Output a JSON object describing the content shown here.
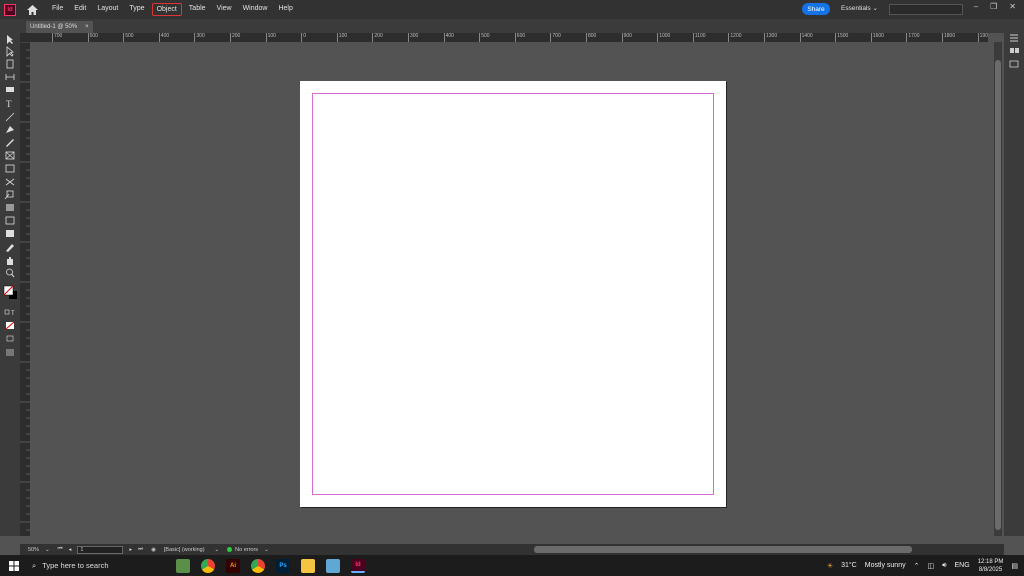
{
  "app": {
    "logo_text": "Id"
  },
  "menu": [
    "File",
    "Edit",
    "Layout",
    "Type",
    "Object",
    "Table",
    "View",
    "Window",
    "Help"
  ],
  "share_label": "Share",
  "workspace_label": "Essentials",
  "doc_tab": {
    "title": "Untitled-1 @ 50%",
    "close": "×"
  },
  "ruler_ticks": [
    "700",
    "600",
    "500",
    "400",
    "300",
    "200",
    "100",
    "0",
    "100",
    "200",
    "300",
    "400",
    "500",
    "600",
    "700",
    "800",
    "900",
    "1000",
    "1100",
    "1200",
    "1300",
    "1400",
    "1500",
    "1600",
    "1700",
    "1800",
    "1900",
    "2000",
    "2100",
    "2200",
    "2300",
    "2400",
    "2500",
    "2600",
    "2700",
    "2800",
    "2900"
  ],
  "status": {
    "zoom": "50%",
    "page": "1",
    "profile": "[Basic] (working)",
    "errors": "No errors"
  },
  "taskbar": {
    "search_placeholder": "Type here to search",
    "weather_temp": "31°C",
    "weather_desc": "Mostly sunny",
    "lang": "ENG",
    "time": "12:18 PM",
    "date": "8/8/2025"
  }
}
